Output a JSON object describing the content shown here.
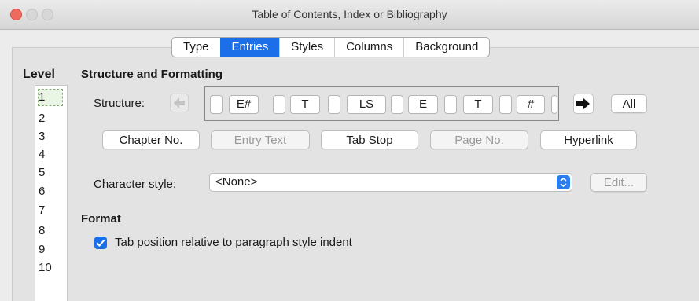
{
  "window": {
    "title": "Table of Contents, Index or Bibliography"
  },
  "tabs": [
    {
      "label": "Type",
      "active": false
    },
    {
      "label": "Entries",
      "active": true
    },
    {
      "label": "Styles",
      "active": false
    },
    {
      "label": "Columns",
      "active": false
    },
    {
      "label": "Background",
      "active": false
    }
  ],
  "level": {
    "title": "Level",
    "items": [
      "1",
      "2",
      "3",
      "4",
      "5",
      "6",
      "7",
      "8",
      "9",
      "10"
    ],
    "selected": "1"
  },
  "structure_formatting": {
    "title": "Structure and Formatting",
    "structure_label": "Structure:",
    "tokens": [
      "E#",
      "T",
      "LS",
      "E",
      "T",
      "#"
    ],
    "all_label": "All",
    "buttons": {
      "chapter_no": "Chapter No.",
      "entry_text": "Entry Text",
      "tab_stop": "Tab Stop",
      "page_no": "Page No.",
      "hyperlink": "Hyperlink"
    },
    "char_style_label": "Character style:",
    "char_style_value": "<None>",
    "edit_label": "Edit..."
  },
  "format": {
    "title": "Format",
    "tab_position_label": "Tab position relative to paragraph style indent",
    "tab_position_checked": true
  },
  "colors": {
    "accent": "#1c6fe8",
    "close": "#ed6a5e"
  }
}
